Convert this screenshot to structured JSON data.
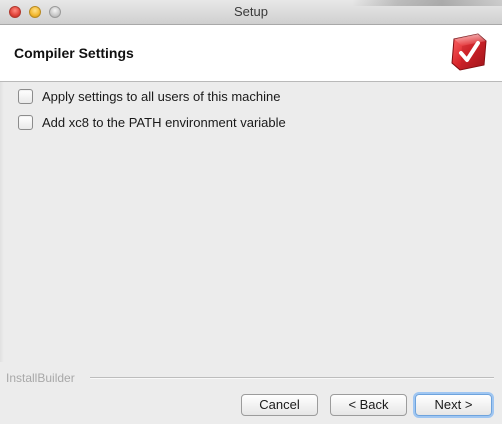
{
  "window": {
    "title": "Setup"
  },
  "header": {
    "title": "Compiler Settings",
    "logo_icon": "installer-logo-icon"
  },
  "options": [
    {
      "label": "Apply settings to all users of this machine",
      "checked": false
    },
    {
      "label": "Add xc8 to the PATH environment variable",
      "checked": false
    }
  ],
  "footer": {
    "brand": "InstallBuilder",
    "buttons": {
      "cancel": "Cancel",
      "back": "< Back",
      "next": "Next >"
    }
  },
  "colors": {
    "logo_red": "#d8262b",
    "focus_ring": "#9fc6f2"
  }
}
